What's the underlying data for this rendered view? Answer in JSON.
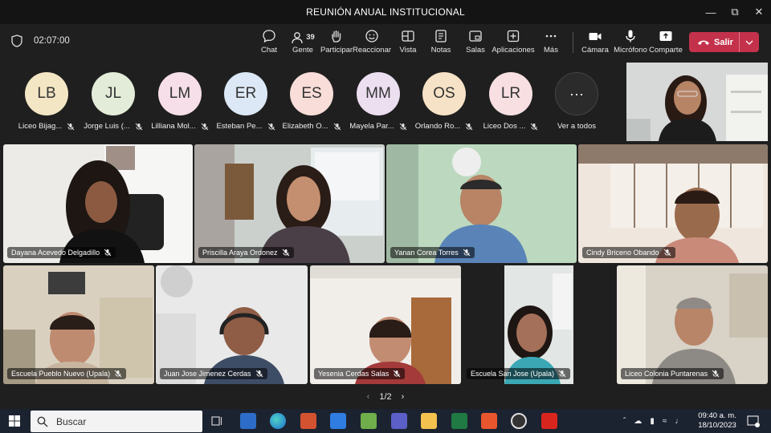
{
  "window": {
    "title": "REUNIÓN ANUAL INSTITUCIONAL"
  },
  "meeting": {
    "timer": "02:07:00",
    "toolbar": [
      {
        "label": "Chat",
        "icon": "chat-icon"
      },
      {
        "label": "Gente",
        "icon": "people-icon",
        "badge": "39"
      },
      {
        "label": "Participar",
        "icon": "raise-hand-icon"
      },
      {
        "label": "Reaccionar",
        "icon": "emoji-icon"
      },
      {
        "label": "Vista",
        "icon": "view-icon"
      },
      {
        "label": "Notas",
        "icon": "notes-icon"
      },
      {
        "label": "Salas",
        "icon": "rooms-icon"
      },
      {
        "label": "Aplicaciones",
        "icon": "apps-icon"
      },
      {
        "label": "Más",
        "icon": "more-icon"
      },
      {
        "label": "Cámara",
        "icon": "camera-icon"
      },
      {
        "label": "Micrófono",
        "icon": "microphone-icon"
      },
      {
        "label": "Comparte",
        "icon": "share-icon"
      }
    ],
    "leave_label": "Salir"
  },
  "avatars": [
    {
      "initials": "LB",
      "name": "Liceo Bijag...",
      "color": "#f3e6c4"
    },
    {
      "initials": "JL",
      "name": "Jorge Luis (...",
      "color": "#e3ecd8"
    },
    {
      "initials": "LM",
      "name": "Lilliana Mol...",
      "color": "#f6dfe8"
    },
    {
      "initials": "ER",
      "name": "Esteban Pe...",
      "color": "#dce8f5"
    },
    {
      "initials": "ES",
      "name": "Elizabeth O...",
      "color": "#f8ddd8"
    },
    {
      "initials": "MM",
      "name": "Mayela Par...",
      "color": "#ecdff0"
    },
    {
      "initials": "OS",
      "name": "Orlando Ro...",
      "color": "#f6e2c6"
    },
    {
      "initials": "LR",
      "name": "Liceo Dos ...",
      "color": "#f7dfe2"
    }
  ],
  "see_all_label": "Ver a todos",
  "participants": [
    {
      "name": "Dayana Acevedo Delgadillo"
    },
    {
      "name": "Priscilla Araya Ordonez"
    },
    {
      "name": "Yanan Corea Torres"
    },
    {
      "name": "Cindy Briceno Obando"
    },
    {
      "name": "Escuela Pueblo Nuevo (Upala)"
    },
    {
      "name": "Juan Jose Jimenez Cerdas"
    },
    {
      "name": "Yesenia Cerdas Salas"
    },
    {
      "name": "Escuela San Jose (Upala)"
    },
    {
      "name": "Liceo Colonia Puntarenas"
    }
  ],
  "pagination": "1/2",
  "taskbar": {
    "search_placeholder": "Buscar",
    "time": "09:40 a. m.",
    "date": "18/10/2023",
    "pinned": [
      "file-explorer-icon",
      "edge-icon",
      "powerpoint-icon",
      "mail-icon",
      "tool-icon",
      "teams-icon",
      "folder-icon",
      "excel-icon",
      "office-icon",
      "media-player-icon",
      "acrobat-icon"
    ]
  }
}
